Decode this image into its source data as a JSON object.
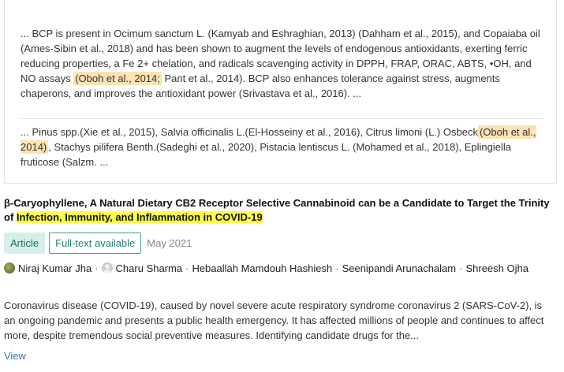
{
  "snippets": [
    {
      "before": "... BCP is present in Ocimum sanctum L. (Kamyab and Eshraghian, 2013) (Dahham et al., 2015), and Copaiaba oil (Ames-Sibin et al., 2018) and has been shown to augment the levels of endogenous antioxidants, exerting ferric reducing properties, a Fe 2+ chelation, and radicals scavenging activity in DPPH, FRAP, ORAC, ABTS, •OH, and NO assays ",
      "highlight": "(Oboh et al., 2014;",
      "after": " Pant et al., 2014). BCP also enhances tolerance against stress, augments chaperons, and improves the antioxidant power (Srivastava et al., 2016). ..."
    },
    {
      "before": "... Pinus spp.(Xie et al., 2015), Salvia officinalis L.(El-Hosseiny et al., 2016), Citrus limoni (L.) Osbeck",
      "highlight": "(Oboh et al., 2014)",
      "after": ", Stachys pilifera Benth.(Sadeghi et al., 2020), Pistacia lentiscus L. (Mohamed et al., 2018), Eplingiella fruticose (Salzm. ..."
    }
  ],
  "publication": {
    "title_part1": "β-Caryophyllene, A Natural Dietary CB2 Receptor Selective Cannabinoid can be a Candidate to Target the Trinity of ",
    "title_highlight": "Infection, Immunity, and Inflammation in COVID-19",
    "type_badge": "Article",
    "fulltext_badge": "Full-text available",
    "date": "May 2021",
    "authors": [
      "Niraj Kumar Jha",
      "Charu Sharma",
      "Hebaallah Mamdouh Hashiesh",
      "Seenipandi Arunachalam",
      "Shreesh Ojha"
    ],
    "author_separator": "·",
    "abstract": "Coronavirus disease (COVID-19), caused by novel severe acute respiratory syndrome coronavirus 2 (SARS-CoV-2), is an ongoing pandemic and presents a public health emergency. It has affected millions of people and continues to affect more, despite tremendous social preventive measures. Identifying candidate drugs for the...",
    "view_label": "View"
  },
  "colors": {
    "citation_highlight": "#fde3b3",
    "title_highlight": "#ffff4a",
    "badge_teal": "#3aa39a",
    "link_blue": "#3973b8"
  }
}
